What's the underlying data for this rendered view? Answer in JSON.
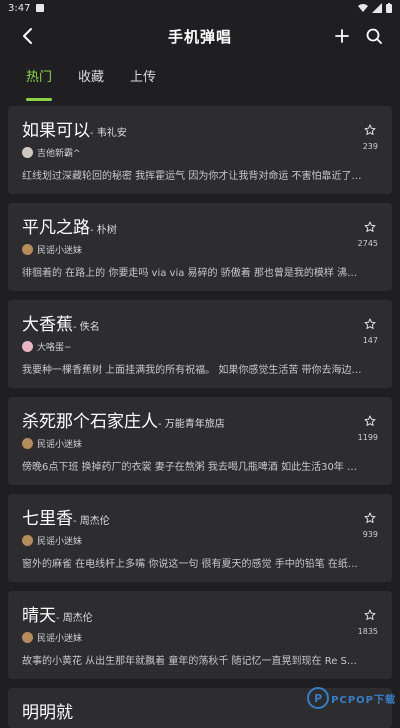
{
  "status": {
    "time": "3:47"
  },
  "header": {
    "title": "手机弹唱"
  },
  "tabs": [
    {
      "label": "热门",
      "active": true
    },
    {
      "label": "收藏",
      "active": false
    },
    {
      "label": "上传",
      "active": false
    }
  ],
  "songs": [
    {
      "title": "如果可以",
      "artist": "- 韦礼安",
      "uploader": "吉他新霸^",
      "stars": "239",
      "excerpt": "红线划过深藏轮回的秘密 我挥霍运气 因为你才让我背对命运 不害怕靠近了相..."
    },
    {
      "title": "平凡之路",
      "artist": "- 朴树",
      "uploader": "民谣小迷妹",
      "stars": "2745",
      "excerpt": "徘徊着的 在路上的 你要走吗 via via 易碎的 骄傲着 那也曾是我的模样 沸腾着的 ..."
    },
    {
      "title": "大香蕉",
      "artist": "- 佚名",
      "uploader": "大咯蛋~",
      "stars": "147",
      "excerpt": "我要种一棵香蕉树 上面挂满我的所有祝福。 如果你感觉生活苦 带你去海边看..."
    },
    {
      "title": "杀死那个石家庄人",
      "artist": "- 万能青年旅店",
      "uploader": "民谣小迷妹",
      "stars": "1199",
      "excerpt": "傍晚6点下班 换掉药厂的衣裳 妻子在熬粥 我去喝几瓶啤酒 如此生活30年 直到..."
    },
    {
      "title": "七里香",
      "artist": "- 周杰伦",
      "uploader": "民谣小迷妹",
      "stars": "939",
      "excerpt": "窗外的麻雀 在电线杆上多嘴 你说这一句 很有夏天的感觉 手中的铅笔 在纸上来..."
    },
    {
      "title": "晴天",
      "artist": "- 周杰伦",
      "uploader": "民谣小迷妹",
      "stars": "1835",
      "excerpt": "故事的小黄花 从出生那年就飘着 童年的荡秋千 随记忆一直晃到现在 Re So So S..."
    }
  ],
  "partial_song": {
    "title": "明明就"
  },
  "watermark": {
    "text": "PCPOP下载"
  },
  "colors": {
    "accent": "#8bd448",
    "card": "#2d2d30",
    "background": "#1f1f21"
  }
}
